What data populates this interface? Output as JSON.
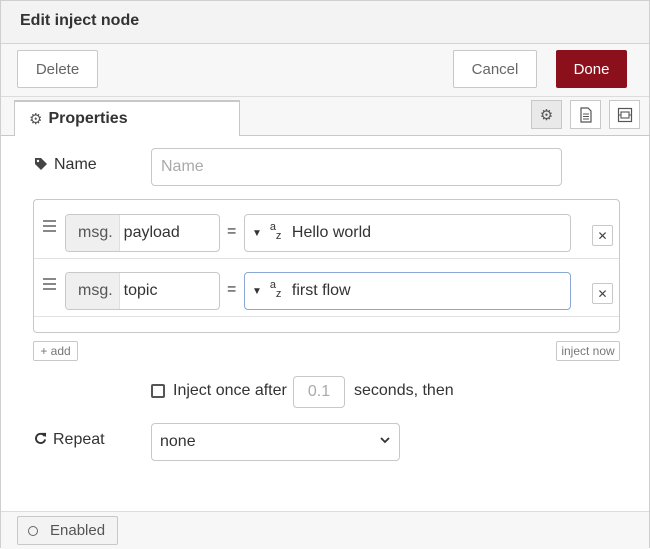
{
  "dialog": {
    "title": "Edit inject node"
  },
  "toolbar": {
    "delete_label": "Delete",
    "cancel_label": "Cancel",
    "done_label": "Done"
  },
  "tabs": {
    "properties_label": "Properties"
  },
  "name_field": {
    "label": "Name",
    "placeholder": "Name",
    "value": ""
  },
  "properties": [
    {
      "prefix": "msg.",
      "field": "payload",
      "equals": "=",
      "type_icon": "az-string-icon",
      "value": "Hello world"
    },
    {
      "prefix": "msg.",
      "field": "topic",
      "equals": "=",
      "type_icon": "az-string-icon",
      "value": "first flow"
    }
  ],
  "actions": {
    "add_label": "+ add",
    "inject_now_label": "inject now"
  },
  "inject_once": {
    "label": "Inject once after",
    "value": "0.1",
    "suffix": "seconds, then",
    "checked": false
  },
  "repeat": {
    "label": "Repeat",
    "selected": "none"
  },
  "footer": {
    "enabled_label": "Enabled"
  },
  "colors": {
    "done_button": "#8c101c",
    "focused_border": "#8aa7d8"
  }
}
